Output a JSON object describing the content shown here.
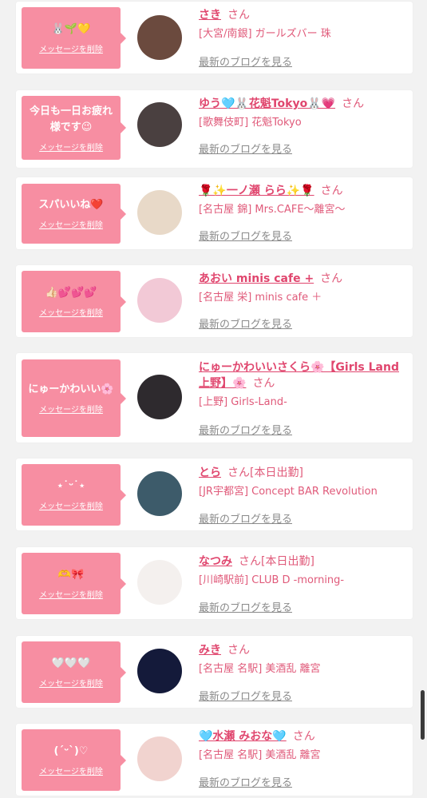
{
  "delete_label": "メッセージを削除",
  "blog_label": "最新のブログを見る",
  "san": "さん",
  "cards": [
    {
      "message": "🐰🌱💛",
      "name": "さき",
      "status": "",
      "shop": "[大宮/南銀] ガールズバー 珠",
      "avatar_color": "#6b4a3e"
    },
    {
      "message": "今日も一日お疲れ様です😉",
      "name": "ゆう🩵🐰花魁Tokyo🐰💗",
      "status": "",
      "shop": "[歌舞伎町] 花魁Tokyo",
      "avatar_color": "#4a4040"
    },
    {
      "message": "スパいいね❤️",
      "name": "🌹✨一ノ瀬 らら✨🌹",
      "status": "",
      "shop": "[名古屋 錦] Mrs.CAFE〜離宮〜",
      "avatar_color": "#e8d9c8"
    },
    {
      "message": "👍🏻💕💕💕",
      "name": "あおい minis cafe +",
      "status": "",
      "shop": "[名古屋 栄] minis cafe ＋",
      "avatar_color": "#f2c9d6"
    },
    {
      "message": "にゅーかわいい🌸",
      "name": "にゅーかわいいさくら🌸【Girls Land上野】🌸",
      "status": "",
      "shop": "[上野] Girls-Land-",
      "avatar_color": "#2e2a2e"
    },
    {
      "message": "⋆˙ᵕ˙⋆",
      "name": "とら",
      "status": "[本日出勤]",
      "shop": "[JR宇都宮] Concept BAR Revolution",
      "avatar_color": "#3d5b6a"
    },
    {
      "message": "🫶🎀",
      "name": "なつみ",
      "status": "[本日出勤]",
      "shop": "[川崎駅前] CLUB D -morning-",
      "avatar_color": "#f4f0ee"
    },
    {
      "message": "🤍🤍🤍",
      "name": "みき",
      "status": "",
      "shop": "[名古屋 名駅] 美酒乱 離宮",
      "avatar_color": "#141a3a"
    },
    {
      "message": "(ˊᵕˋ)♡",
      "name": "🩵水瀬 みおな🩵",
      "status": "",
      "shop": "[名古屋 名駅] 美酒乱 離宮",
      "avatar_color": "#f1d3cf"
    }
  ]
}
